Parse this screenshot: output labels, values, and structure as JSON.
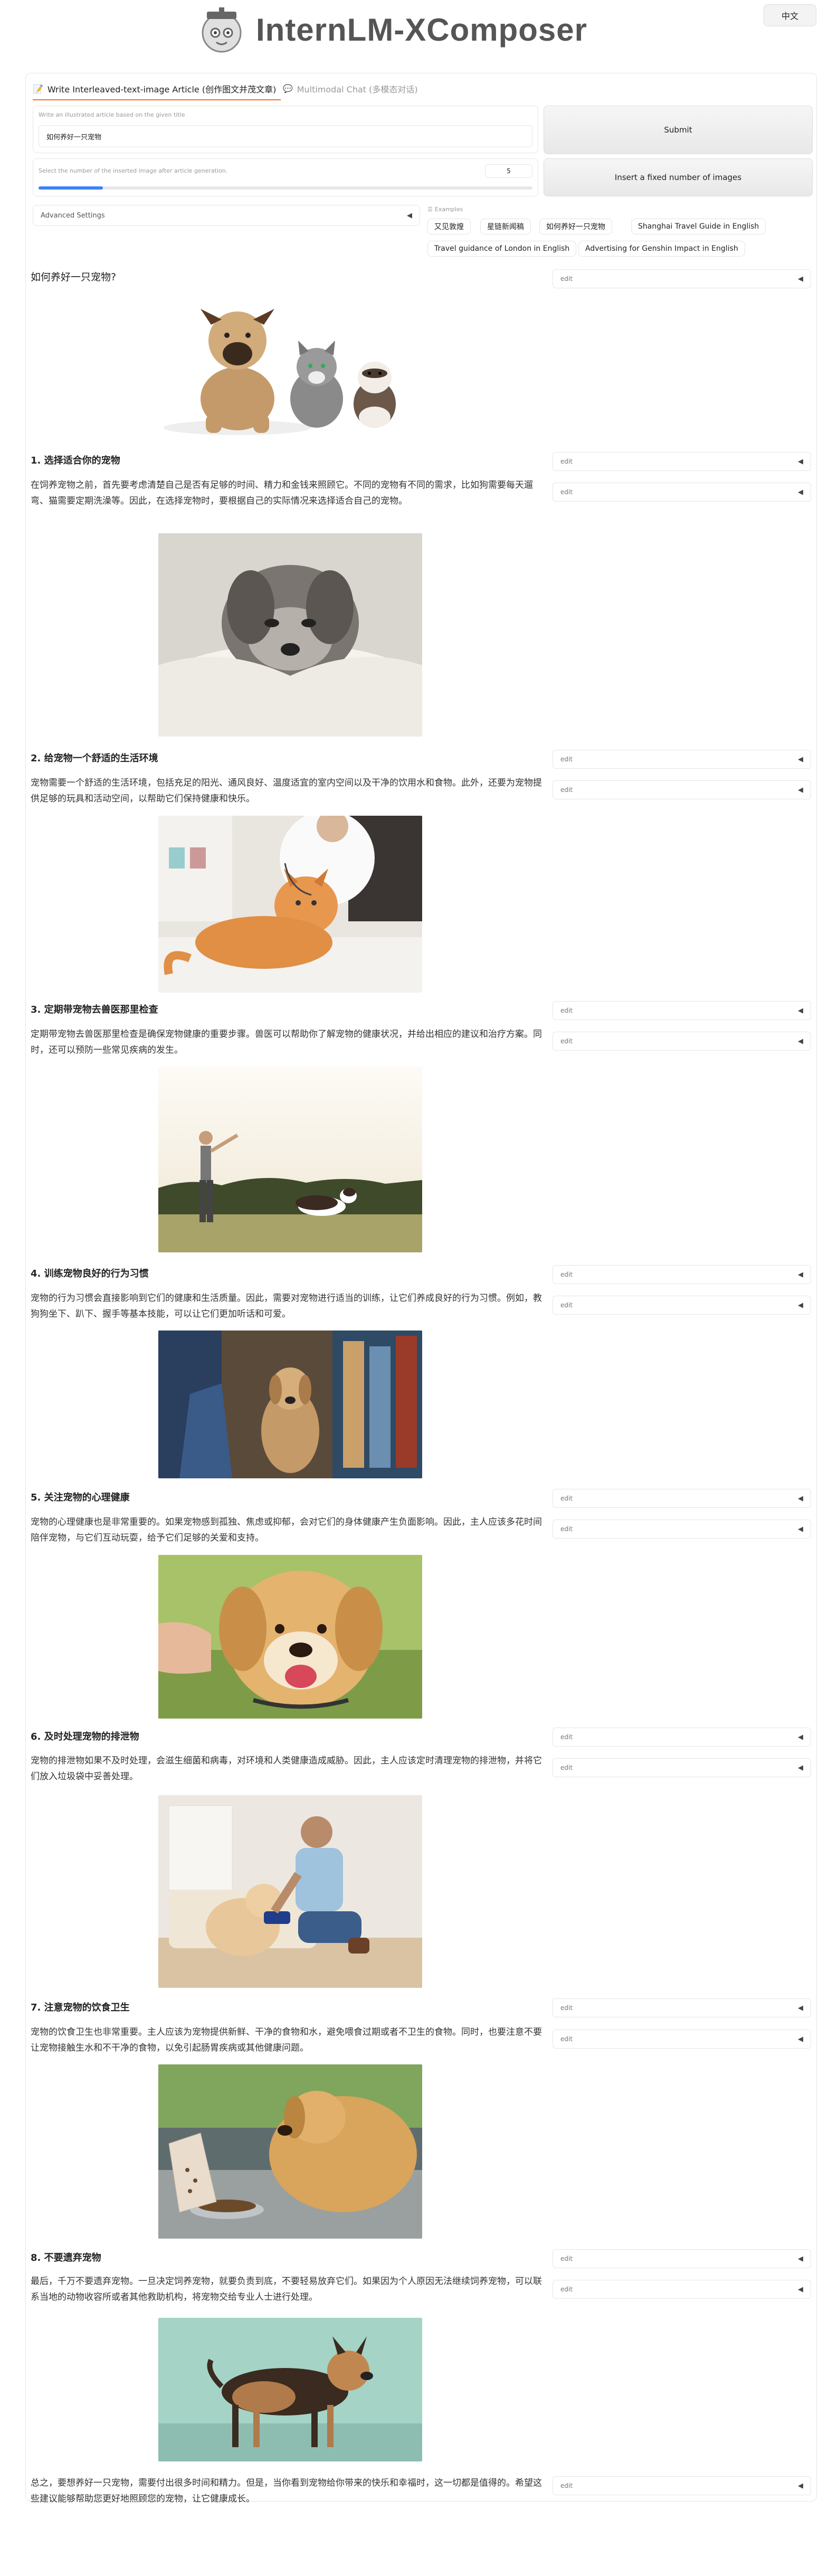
{
  "app": {
    "title": "InternLM-XComposer",
    "lang_button": "中文"
  },
  "tabs": [
    {
      "label": "Write Interleaved-text-image Article (创作图文并茂文章)",
      "active": true
    },
    {
      "label": "Multimodal Chat (多模态对话)",
      "active": false
    }
  ],
  "form": {
    "instruction_label": "Write an illustrated article based on the given title",
    "instruction_value": "如何养好一只宠物",
    "submit_label": "Submit",
    "slider_label": "Select the number of the inserted image after article generation.",
    "slider_value": "5",
    "slider_fraction": 0.13,
    "insert_label": "Insert a fixed number of images",
    "advanced_label": "Advanced Settings",
    "examples_label": "Examples",
    "examples": [
      "又见敦煌",
      "星链新闻稿",
      "如何养好一只宠物",
      "Shanghai Travel Guide in English",
      "Travel guidance of London in English",
      "Advertising for Genshin Impact in English"
    ]
  },
  "article": {
    "title": "如何养好一只宠物?",
    "edit_label": "edit",
    "sections": [
      {
        "heading": "1. 选择适合你的宠物",
        "text": "在饲养宠物之前，首先要考虑清楚自己是否有足够的时间、精力和金钱来照顾它。不同的宠物有不同的需求，比如狗需要每天遛弯、猫需要定期洗澡等。因此，在选择宠物时，要根据自己的实际情况来选择适合自己的宠物。"
      },
      {
        "heading": "2. 给宠物一个舒适的生活环境",
        "text": "宠物需要一个舒适的生活环境，包括充足的阳光、通风良好、温度适宜的室内空间以及干净的饮用水和食物。此外，还要为宠物提供足够的玩具和活动空间，以帮助它们保持健康和快乐。"
      },
      {
        "heading": "3. 定期带宠物去兽医那里检查",
        "text": "定期带宠物去兽医那里检查是确保宠物健康的重要步骤。兽医可以帮助你了解宠物的健康状况，并给出相应的建议和治疗方案。同时，还可以预防一些常见疾病的发生。"
      },
      {
        "heading": "4. 训练宠物良好的行为习惯",
        "text": "宠物的行为习惯会直接影响到它们的健康和生活质量。因此，需要对宠物进行适当的训练，让它们养成良好的行为习惯。例如，教狗狗坐下、趴下、握手等基本技能，可以让它们更加听话和可爱。"
      },
      {
        "heading": "5. 关注宠物的心理健康",
        "text": "宠物的心理健康也是非常重要的。如果宠物感到孤独、焦虑或抑郁，会对它们的身体健康产生负面影响。因此，主人应该多花时间陪伴宠物，与它们互动玩耍，给予它们足够的关爱和支持。"
      },
      {
        "heading": "6. 及时处理宠物的排泄物",
        "text": "宠物的排泄物如果不及时处理，会滋生细菌和病毒，对环境和人类健康造成威胁。因此，主人应该定时清理宠物的排泄物，并将它们放入垃圾袋中妥善处理。"
      },
      {
        "heading": "7. 注意宠物的饮食卫生",
        "text": "宠物的饮食卫生也非常重要。主人应该为宠物提供新鲜、干净的食物和水，避免喂食过期或者不卫生的食物。同时，也要注意不要让宠物接触生水和不干净的食物，以免引起肠胃疾病或其他健康问题。"
      },
      {
        "heading": "8. 不要遗弃宠物",
        "text": "最后，千万不要遗弃宠物。一旦决定饲养宠物，就要负责到底，不要轻易放弃它们。如果因为个人原因无法继续饲养宠物，可以联系当地的动物收容所或者其他救助机构，将宠物交给专业人士进行处理。"
      }
    ],
    "conclusion": "总之，要想养好一只宠物，需要付出很多时间和精力。但是，当你看到宠物给你带来的快乐和幸福时，这一切都是值得的。希望这些建议能够帮助您更好地照顾您的宠物，让它健康成长。"
  },
  "colors": {
    "slider_fill": "#3b82f6",
    "border": "#e6e6e6",
    "title_grey": "#555555"
  }
}
